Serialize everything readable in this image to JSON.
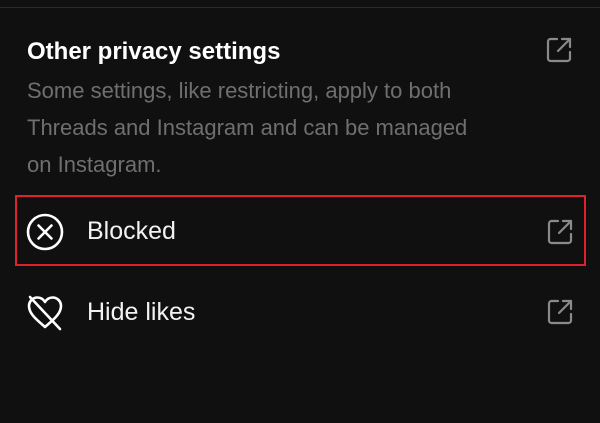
{
  "privacy": {
    "title": "Other privacy settings",
    "description": "Some settings, like restricting, apply to both Threads and Instagram and can be managed on Instagram.",
    "external_link_icon": "external-link-icon"
  },
  "rows": [
    {
      "label": "Blocked",
      "icon": "blocked-x-circle-icon",
      "trailing_icon": "external-link-icon",
      "highlighted": true
    },
    {
      "label": "Hide likes",
      "icon": "heart-slash-icon",
      "trailing_icon": "external-link-icon",
      "highlighted": false
    }
  ],
  "colors": {
    "background": "#101010",
    "primary_text": "#ffffff",
    "secondary_text": "#6f6f6f",
    "icon_muted": "#8a8a8a",
    "highlight": "#e0202a"
  }
}
